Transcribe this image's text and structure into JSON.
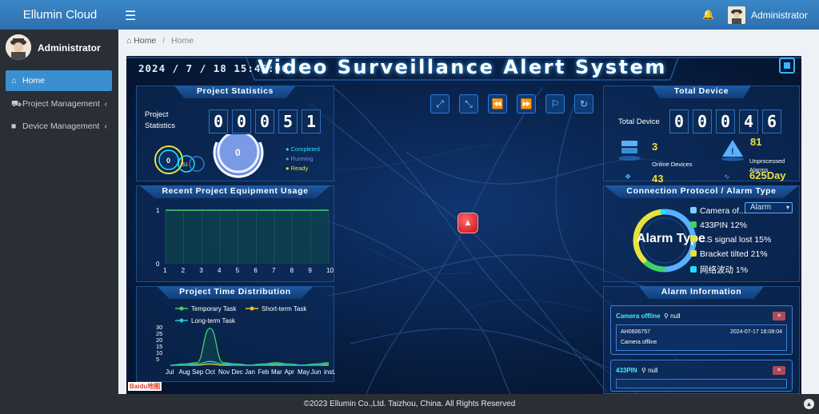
{
  "brand": "Ellumin Cloud",
  "top_user": "Administrator",
  "side_user": "Administrator",
  "nav": [
    {
      "label": "Home",
      "icon": "home-icon"
    },
    {
      "label": "Project Management",
      "icon": "truck-icon"
    },
    {
      "label": "Device Management",
      "icon": "video-icon"
    }
  ],
  "breadcrumb": {
    "home": "Home",
    "current": "Home"
  },
  "dashboard": {
    "datetime": "2024 / 7 / 18 15:45:06",
    "title": "Video Surveillance Alert System",
    "project_stats": {
      "title": "Project Statistics",
      "label_line1": "Project",
      "label_line2": "Statistics",
      "digits": [
        "0",
        "0",
        "0",
        "5",
        "1"
      ],
      "gauge_small": "0",
      "gauge_small2": "51",
      "gauge_big": "0",
      "legend": [
        {
          "label": "Completed",
          "color": "#22e1ff"
        },
        {
          "label": "Running",
          "color": "#7c8bd6"
        },
        {
          "label": "Ready",
          "color": "#e8e23c"
        }
      ]
    },
    "total_device": {
      "title": "Total Device",
      "label": "Total Device",
      "digits": [
        "0",
        "0",
        "0",
        "4",
        "6"
      ],
      "online_value": "3",
      "online_label": "Online Devices",
      "unprocessed_value": "81",
      "unprocessed_label_line1": "Unprocessed",
      "unprocessed_label_line2": "Alarms",
      "days_value": "625Day",
      "extra_value": "43"
    },
    "equipment_usage": {
      "title": "Recent Project Equipment Usage"
    },
    "time_distribution": {
      "title": "Project Time Distribution",
      "legend": [
        {
          "label": "Temporary Task",
          "color": "#3dd36a"
        },
        {
          "label": "Short-term Task",
          "color": "#f2c31b"
        },
        {
          "label": "Long-term Task",
          "color": "#23c9d6"
        }
      ]
    },
    "connection": {
      "title": "Connection Protocol / Alarm Type",
      "select_value": "Alarm",
      "center_label": "Alarm Type",
      "legend": [
        {
          "label": "Camera of...",
          "pct": "",
          "color": "#7fd0ff"
        },
        {
          "label": "433PIN",
          "pct": "12%",
          "color": "#3dd36a"
        },
        {
          "label": "...S signal lost",
          "pct": "15%",
          "color": "#e8e23c"
        },
        {
          "label": "Bracket tilted",
          "pct": "21%",
          "color": "#e8e23c"
        },
        {
          "label": "网络波动",
          "pct": "1%",
          "color": "#22e1ff"
        }
      ]
    },
    "alarm_info": {
      "title": "Alarm Information",
      "cards": [
        {
          "type": "Camera offline",
          "location": "null",
          "id": "AH0606757",
          "time": "2024-07-17 16:08:04",
          "desc": "Camera offline"
        },
        {
          "type": "433PIN",
          "location": "null"
        }
      ]
    },
    "baidu": "Baidu地图"
  },
  "chart_data": [
    {
      "type": "line",
      "title": "Recent Project Equipment Usage",
      "x": [
        1,
        2,
        3,
        4,
        5,
        6,
        7,
        8,
        9,
        10
      ],
      "series": [
        {
          "values": [
            1,
            1,
            1,
            1,
            1,
            1,
            1,
            1,
            1,
            1
          ]
        }
      ],
      "ylim": [
        0,
        1
      ],
      "yticks": [
        0,
        1
      ],
      "grid": true
    },
    {
      "type": "line",
      "title": "Project Time Distribution",
      "categories": [
        "Jul",
        "Aug",
        "Sep",
        "Oct",
        "Nov",
        "Dec",
        "Jan",
        "Feb",
        "Mar",
        "Apr",
        "May",
        "Jun",
        "inst."
      ],
      "series": [
        {
          "name": "Temporary Task",
          "color": "#3dd36a",
          "values": [
            0,
            1,
            2,
            29,
            2,
            1,
            0,
            1,
            2,
            1,
            0,
            1,
            2
          ]
        },
        {
          "name": "Short-term Task",
          "color": "#f2c31b",
          "values": [
            0,
            0,
            0,
            1,
            0,
            0,
            0,
            0,
            0,
            0,
            0,
            0,
            0
          ]
        },
        {
          "name": "Long-term Task",
          "color": "#23c9d6",
          "values": [
            0,
            0,
            1,
            3,
            1,
            0,
            0,
            0,
            1,
            0,
            0,
            0,
            1
          ]
        }
      ],
      "ylim": [
        0,
        30
      ],
      "yticks": [
        5,
        10,
        15,
        20,
        25,
        30
      ],
      "legend": "top"
    },
    {
      "type": "pie",
      "title": "Alarm Type",
      "categories": [
        "Camera offline",
        "433PIN",
        "GPS signal lost",
        "Bracket tilted",
        "网络波动"
      ],
      "values": [
        51,
        12,
        15,
        21,
        1
      ]
    }
  ]
}
